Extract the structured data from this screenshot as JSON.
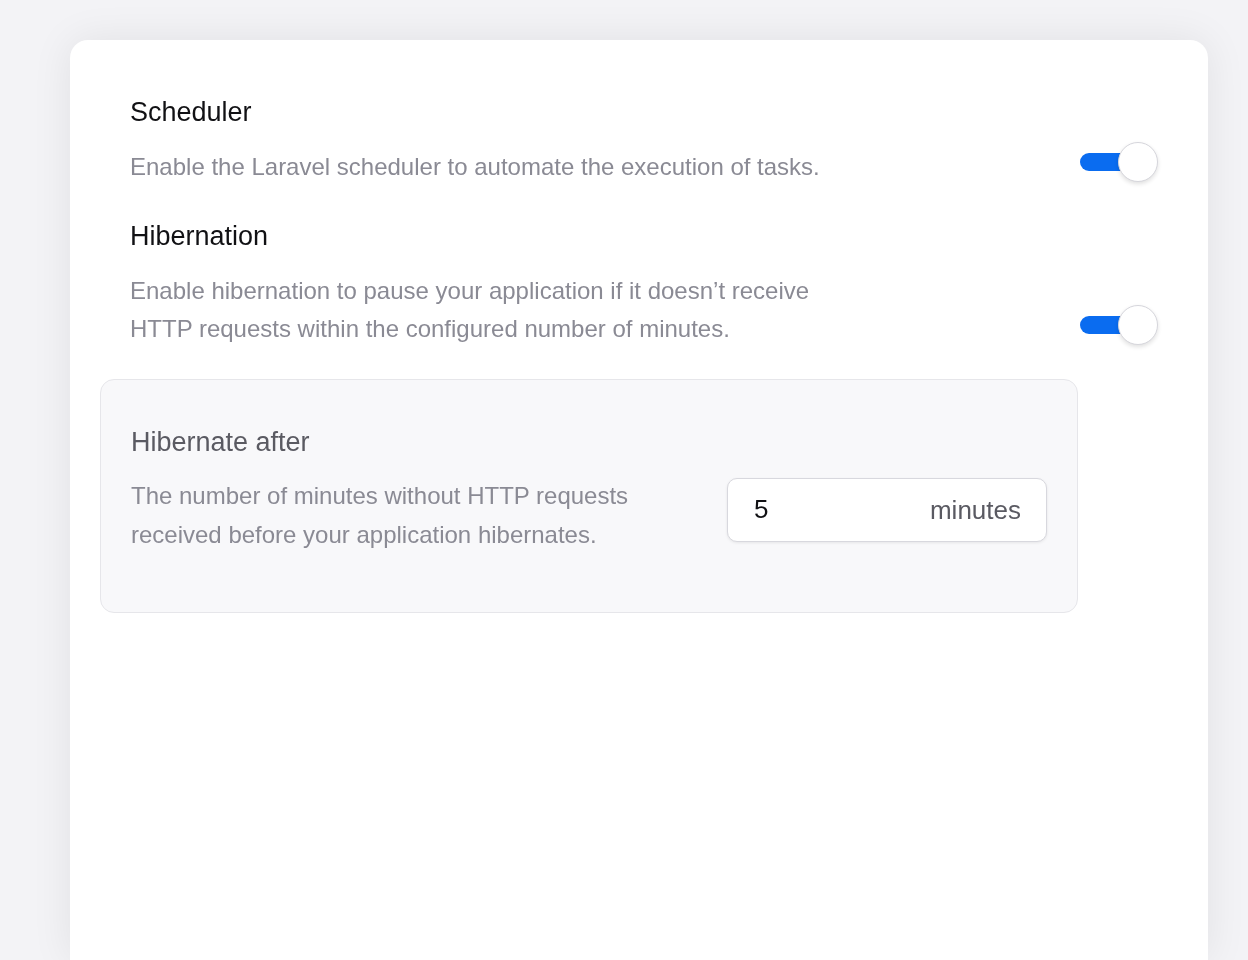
{
  "settings": [
    {
      "title": "Scheduler",
      "description": "Enable the Laravel scheduler to automate the execution of tasks.",
      "on": true
    },
    {
      "title": "Hibernation",
      "description": "Enable hibernation to pause your application if it doesn’t receive HTTP requests within the configured number of minutes.",
      "on": true
    }
  ],
  "hibernate_after": {
    "title": "Hibernate after",
    "description": "The number of minutes without HTTP requests received before your application hibernates.",
    "value": "5",
    "unit": "minutes"
  }
}
